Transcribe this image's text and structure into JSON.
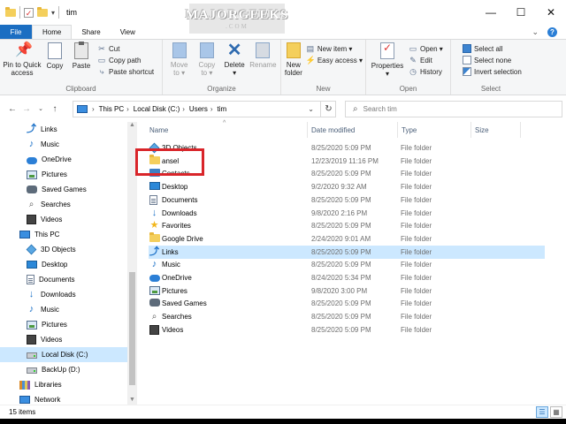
{
  "window": {
    "title": "tim",
    "watermark_main": "MAJORGEEKS",
    "watermark_sub": ".COM",
    "controls": {
      "minimize": "—",
      "maximize": "☐",
      "close": "✕"
    }
  },
  "tabs": {
    "file": "File",
    "home": "Home",
    "share": "Share",
    "view": "View"
  },
  "ribbon": {
    "clipboard": {
      "label": "Clipboard",
      "pin_line1": "Pin to Quick",
      "pin_line2": "access",
      "copy": "Copy",
      "paste": "Paste",
      "cut": "Cut",
      "copy_path": "Copy path",
      "paste_shortcut": "Paste shortcut"
    },
    "organize": {
      "label": "Organize",
      "move_to_line1": "Move",
      "move_to_line2": "to ▾",
      "copy_to_line1": "Copy",
      "copy_to_line2": "to ▾",
      "delete": "Delete",
      "delete_arrow": "▾",
      "rename": "Rename"
    },
    "new": {
      "label": "New",
      "new_folder_line1": "New",
      "new_folder_line2": "folder",
      "new_item": "New item ▾",
      "easy_access": "Easy access ▾"
    },
    "open": {
      "label": "Open",
      "properties": "Properties",
      "properties_arrow": "▾",
      "open": "Open ▾",
      "edit": "Edit",
      "history": "History"
    },
    "select": {
      "label": "Select",
      "select_all": "Select all",
      "select_none": "Select none",
      "invert_selection": "Invert selection"
    }
  },
  "address": {
    "crumbs": [
      "This PC",
      "Local Disk (C:)",
      "Users",
      "tim"
    ],
    "search_placeholder": "Search tim"
  },
  "nav_pane": {
    "items": [
      {
        "label": "Links",
        "icon": "link-icon"
      },
      {
        "label": "Music",
        "icon": "music-icon"
      },
      {
        "label": "OneDrive",
        "icon": "cloud-icon"
      },
      {
        "label": "Pictures",
        "icon": "pictures-icon"
      },
      {
        "label": "Saved Games",
        "icon": "game-icon"
      },
      {
        "label": "Searches",
        "icon": "search-icon"
      },
      {
        "label": "Videos",
        "icon": "video-icon"
      },
      {
        "label": "This PC",
        "icon": "computer-icon"
      },
      {
        "label": "3D Objects",
        "icon": "cube-icon"
      },
      {
        "label": "Desktop",
        "icon": "desktop-icon"
      },
      {
        "label": "Documents",
        "icon": "documents-icon"
      },
      {
        "label": "Downloads",
        "icon": "download-icon"
      },
      {
        "label": "Music",
        "icon": "music-icon"
      },
      {
        "label": "Pictures",
        "icon": "pictures-icon"
      },
      {
        "label": "Videos",
        "icon": "video-icon"
      },
      {
        "label": "Local Disk (C:)",
        "icon": "drive-icon"
      },
      {
        "label": "BackUp (D:)",
        "icon": "drive-icon"
      },
      {
        "label": "Libraries",
        "icon": "library-icon"
      },
      {
        "label": "Network",
        "icon": "network-icon"
      }
    ]
  },
  "file_list": {
    "columns": {
      "name": "Name",
      "date": "Date modified",
      "type": "Type",
      "size": "Size"
    },
    "rows": [
      {
        "name": "3D Objects",
        "date": "8/25/2020 5:09 PM",
        "type": "File folder",
        "icon": "cube-icon"
      },
      {
        "name": "ansel",
        "date": "12/23/2019 11:16 PM",
        "type": "File folder",
        "icon": "folder-icon"
      },
      {
        "name": "Contacts",
        "date": "8/25/2020 5:09 PM",
        "type": "File folder",
        "icon": "contacts-icon"
      },
      {
        "name": "Desktop",
        "date": "9/2/2020 9:32 AM",
        "type": "File folder",
        "icon": "desktop-icon"
      },
      {
        "name": "Documents",
        "date": "8/25/2020 5:09 PM",
        "type": "File folder",
        "icon": "documents-icon"
      },
      {
        "name": "Downloads",
        "date": "9/8/2020 2:16 PM",
        "type": "File folder",
        "icon": "download-icon"
      },
      {
        "name": "Favorites",
        "date": "8/25/2020 5:09 PM",
        "type": "File folder",
        "icon": "star-icon"
      },
      {
        "name": "Google Drive",
        "date": "2/24/2020 9:01 AM",
        "type": "File folder",
        "icon": "folder-icon"
      },
      {
        "name": "Links",
        "date": "8/25/2020 5:09 PM",
        "type": "File folder",
        "icon": "link-icon"
      },
      {
        "name": "Music",
        "date": "8/25/2020 5:09 PM",
        "type": "File folder",
        "icon": "music-icon"
      },
      {
        "name": "OneDrive",
        "date": "8/24/2020 5:34 PM",
        "type": "File folder",
        "icon": "cloud-icon"
      },
      {
        "name": "Pictures",
        "date": "9/8/2020 3:00 PM",
        "type": "File folder",
        "icon": "pictures-icon"
      },
      {
        "name": "Saved Games",
        "date": "8/25/2020 5:09 PM",
        "type": "File folder",
        "icon": "game-icon"
      },
      {
        "name": "Searches",
        "date": "8/25/2020 5:09 PM",
        "type": "File folder",
        "icon": "search-icon"
      },
      {
        "name": "Videos",
        "date": "8/25/2020 5:09 PM",
        "type": "File folder",
        "icon": "video-icon"
      }
    ],
    "selected_row": "Links"
  },
  "status": {
    "item_count": "15 items"
  },
  "colors": {
    "accent": "#1b6ec2",
    "selection": "#cce8ff",
    "highlight_box": "#d9252a"
  }
}
